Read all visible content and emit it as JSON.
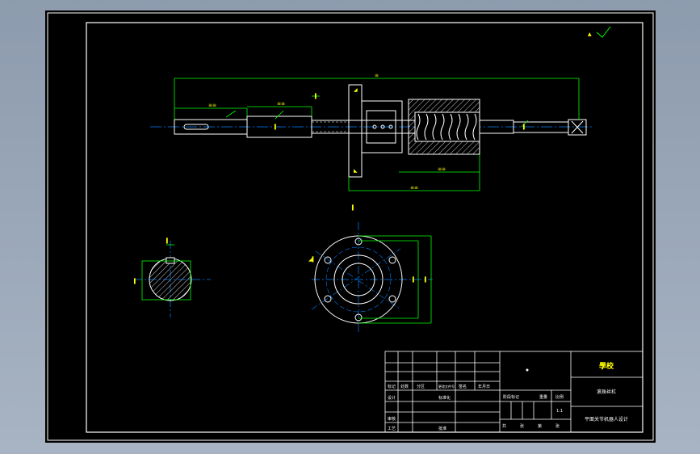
{
  "title_block": {
    "company": "學校",
    "drawing_name": "滚珠丝杠",
    "project": "平面关节机器人设计",
    "row_labels": [
      "标记",
      "处数",
      "分区",
      "更改文件号",
      "签名",
      "年月日"
    ],
    "role_labels": [
      "设计",
      "标准化",
      "审核",
      "工艺",
      "批准"
    ],
    "stage_labels": [
      "阶段标记",
      "重量",
      "比例"
    ],
    "sheet_labels": [
      "共",
      "张",
      "第",
      "张"
    ],
    "scale": "1:1"
  },
  "colors": {
    "background": "#000000",
    "frame": "#ffffff",
    "dimension": "#00ff00",
    "text": "#ffff00",
    "centerline": "#0080ff",
    "hatch": "#ffffff",
    "part": "#ffffff"
  }
}
